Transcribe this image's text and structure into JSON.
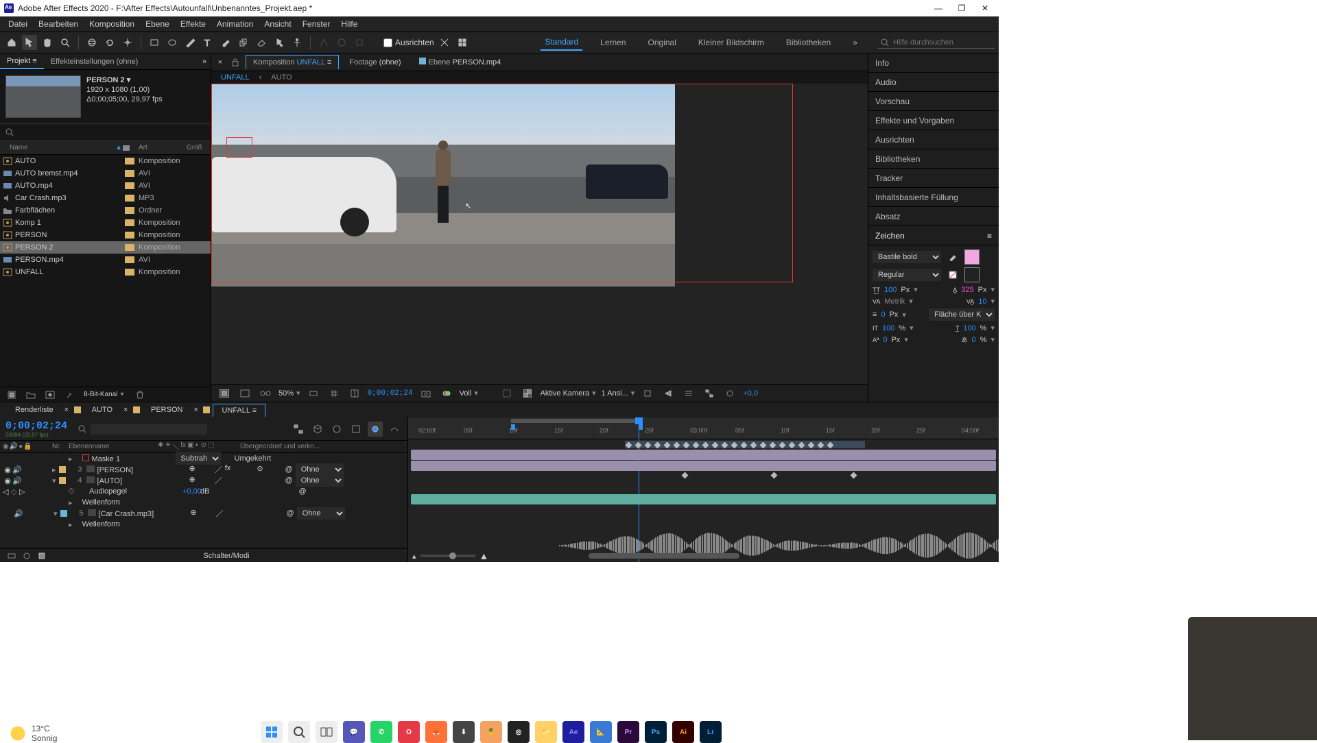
{
  "window": {
    "title": "Adobe After Effects 2020 - F:\\After Effects\\Autounfall\\Unbenanntes_Projekt.aep *"
  },
  "menus": [
    "Datei",
    "Bearbeiten",
    "Komposition",
    "Ebene",
    "Effekte",
    "Animation",
    "Ansicht",
    "Fenster",
    "Hilfe"
  ],
  "toolbar": {
    "align_label": "Ausrichten",
    "search_placeholder": "Hilfe durchsuchen"
  },
  "workspaces": [
    "Standard",
    "Lernen",
    "Original",
    "Kleiner Bildschirm",
    "Bibliotheken"
  ],
  "active_workspace": "Standard",
  "project_panel": {
    "tab_project": "Projekt",
    "tab_effect": "Effekteinstellungen  (ohne)",
    "selected_name": "PERSON 2",
    "selected_dim": "1920 x 1080 (1,00)",
    "selected_dur": "Δ0;00;05;00, 29,97 fps",
    "columns": {
      "name": "Name",
      "type_icon": "",
      "type": "Art",
      "size": "Größ"
    },
    "items": [
      {
        "name": "AUTO",
        "type": "Komposition",
        "color": "#d8b36a",
        "icon": "comp"
      },
      {
        "name": "AUTO bremst.mp4",
        "type": "AVI",
        "color": "#d8b36a",
        "icon": "video"
      },
      {
        "name": "AUTO.mp4",
        "type": "AVI",
        "color": "#d8b36a",
        "icon": "video"
      },
      {
        "name": "Car Crash.mp3",
        "type": "MP3",
        "color": "#d8b36a",
        "icon": "audio"
      },
      {
        "name": "Farbflächen",
        "type": "Ordner",
        "color": "#d8b36a",
        "icon": "folder"
      },
      {
        "name": "Komp 1",
        "type": "Komposition",
        "color": "#d8b36a",
        "icon": "comp"
      },
      {
        "name": "PERSON",
        "type": "Komposition",
        "color": "#d8b36a",
        "icon": "comp"
      },
      {
        "name": "PERSON 2",
        "type": "Komposition",
        "color": "#d8b36a",
        "icon": "comp",
        "selected": true
      },
      {
        "name": "PERSON.mp4",
        "type": "AVI",
        "color": "#d8b36a",
        "icon": "video"
      },
      {
        "name": "UNFALL",
        "type": "Komposition",
        "color": "#d8b36a",
        "icon": "comp"
      }
    ],
    "bits": "8-Bit-Kanal"
  },
  "viewer": {
    "tabs": [
      {
        "label": "Komposition",
        "name": "UNFALL",
        "active": true
      },
      {
        "label": "Footage",
        "name": "(ohne)"
      },
      {
        "label": "Ebene",
        "name": "PERSON.mp4"
      }
    ],
    "crumb": [
      "UNFALL",
      "‹",
      "AUTO"
    ],
    "zoom": "50%",
    "time": "0;00;02;24",
    "res": "Voll",
    "camera": "Aktive Kamera",
    "views": "1 Ansi...",
    "exposure": "+0,0"
  },
  "right_panels": [
    "Info",
    "Audio",
    "Vorschau",
    "Effekte und Vorgaben",
    "Ausrichten",
    "Bibliotheken",
    "Tracker",
    "Inhaltsbasierte Füllung",
    "Absatz"
  ],
  "character": {
    "title": "Zeichen",
    "font": "Bastile bold",
    "style": "Regular",
    "size": "100",
    "size_unit": "Px",
    "leading": "325",
    "leading_unit": "Px",
    "kerning": "Metrik",
    "tracking": "10",
    "stroke": "0",
    "stroke_unit": "Px",
    "stroke_opt": "Fläche über Kon...",
    "vscale": "100",
    "hscale": "100",
    "scale_unit": "%",
    "baseline": "0",
    "baseline_unit": "Px",
    "tsume": "0",
    "tsume_unit": "%"
  },
  "timeline": {
    "tabs": [
      "Renderliste",
      "AUTO",
      "PERSON",
      "UNFALL"
    ],
    "active": "UNFALL",
    "timecode": "0;00;02;24",
    "frame_note": "00084 (29,97 fps)",
    "cols": {
      "num": "Nr.",
      "name": "Ebenenname",
      "parent": "Übergeordnet und verkn..."
    },
    "mask": "Maske 1",
    "mask_mode": "Subtrahi",
    "mask_inv": "Umgekehrt",
    "layers": [
      {
        "n": "3",
        "name": "[PERSON]",
        "parent": "Ohne",
        "color": "#d8b36a"
      },
      {
        "n": "4",
        "name": "[AUTO]",
        "parent": "Ohne",
        "color": "#d8b36a"
      }
    ],
    "audio_prop": "Audiopegel",
    "audio_val": "+0,00",
    "audio_unit": "dB",
    "waveform": "Wellenform",
    "layer5": {
      "n": "5",
      "name": "[Car Crash.mp3]",
      "parent": "Ohne",
      "color": "#6ab4d8"
    },
    "switches": "Schalter/Modi",
    "ticks": [
      "02:00f",
      "05f",
      "10f",
      "15f",
      "20f",
      "25f",
      "03:00f",
      "05f",
      "10f",
      "15f",
      "20f",
      "25f",
      "04:00f"
    ]
  },
  "taskbar": {
    "temp": "13°C",
    "cond": "Sonnig"
  }
}
